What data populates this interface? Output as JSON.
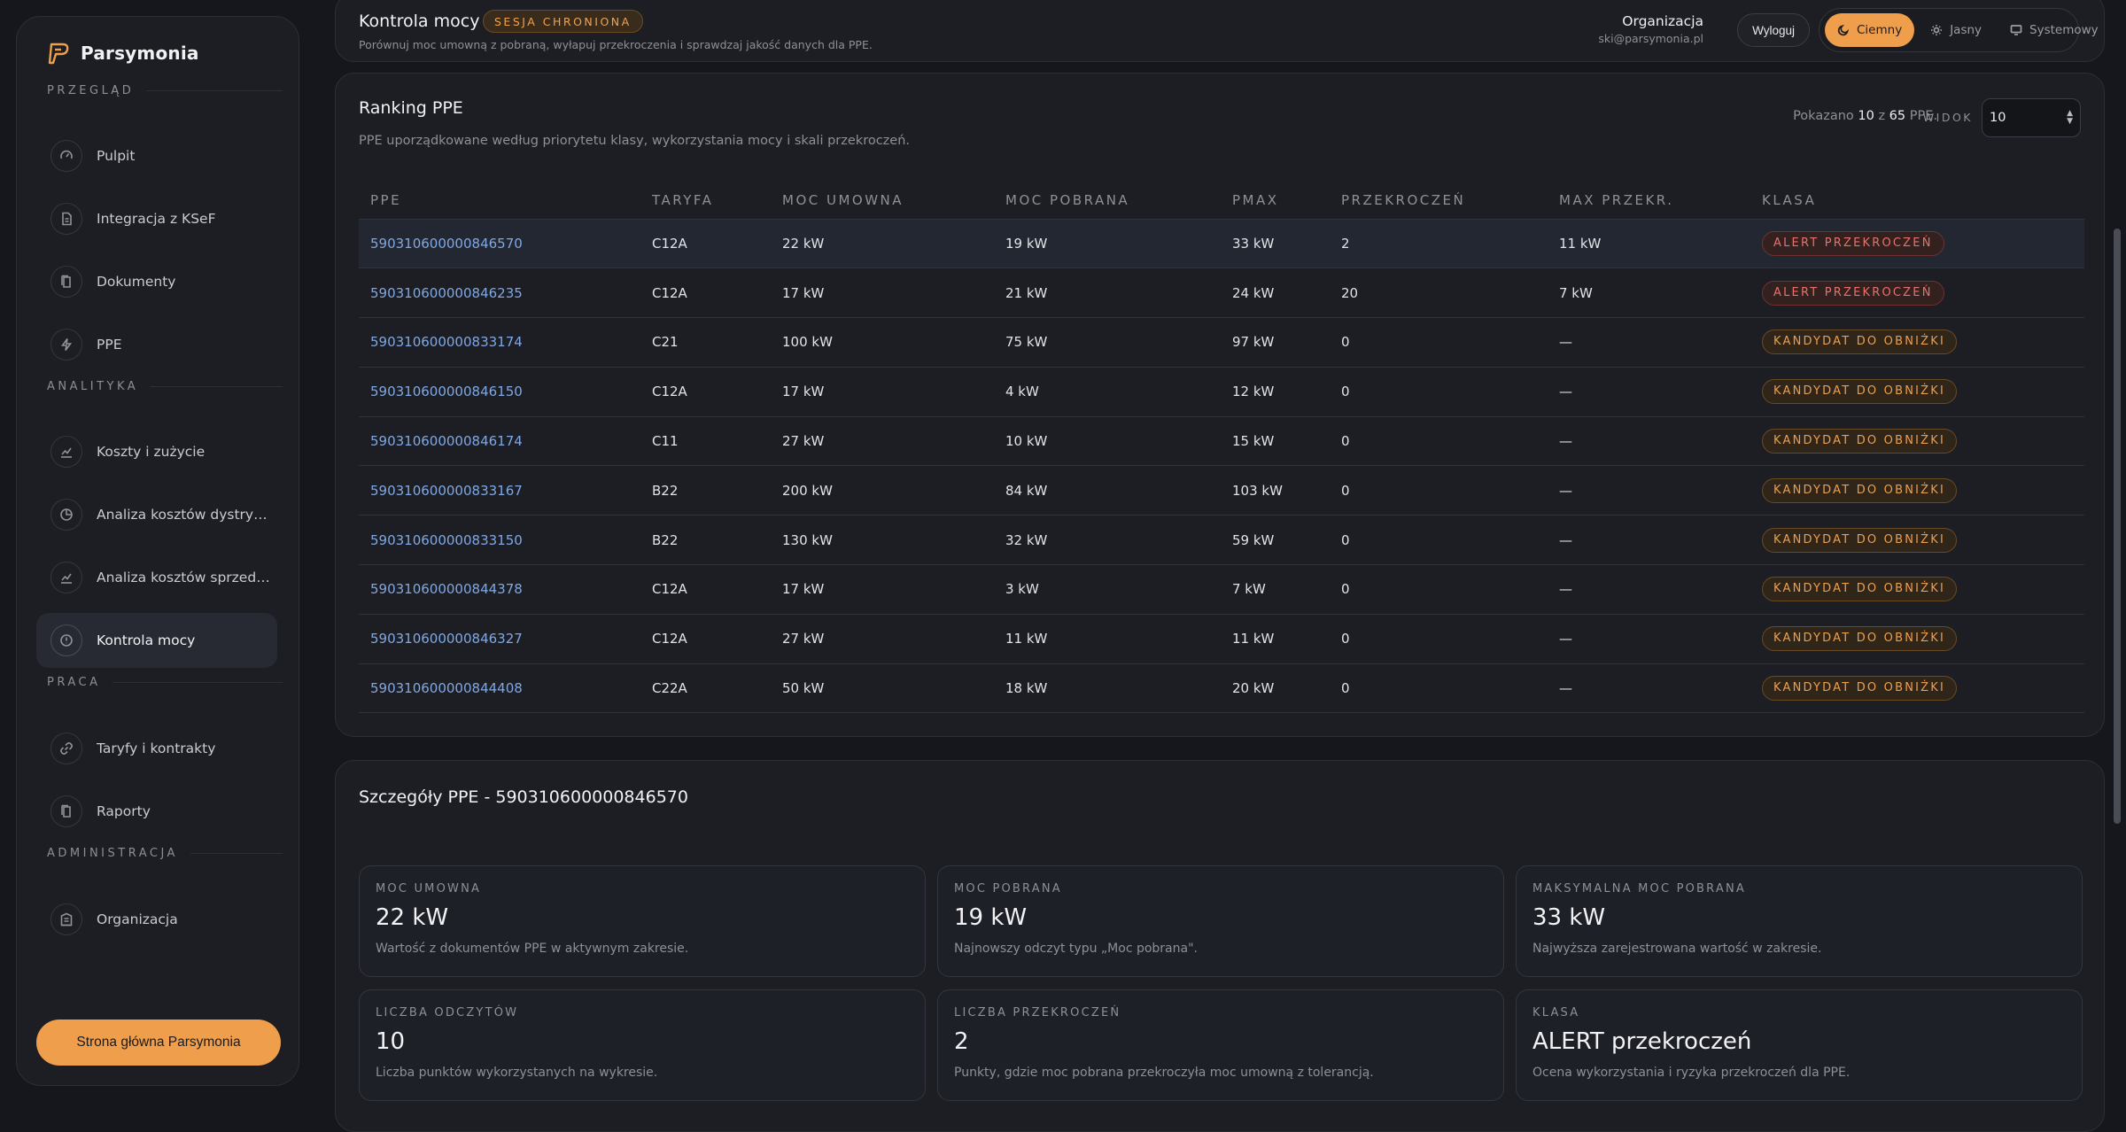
{
  "app": {
    "brand": "Parsymonia"
  },
  "sidebar": {
    "sections": [
      {
        "label": "PRZEGLĄD"
      },
      {
        "label": "ANALITYKA"
      },
      {
        "label": "PRACA"
      },
      {
        "label": "ADMINISTRACJA"
      }
    ],
    "items": [
      {
        "label": "Pulpit",
        "icon": "gauge-icon"
      },
      {
        "label": "Integracja z KSeF",
        "icon": "document-icon"
      },
      {
        "label": "Dokumenty",
        "icon": "documents-icon"
      },
      {
        "label": "PPE",
        "icon": "bolt-icon"
      },
      {
        "label": "Koszty i zużycie",
        "icon": "chart-icon"
      },
      {
        "label": "Analiza kosztów dystrybucji",
        "icon": "pie-icon"
      },
      {
        "label": "Analiza kosztów sprzedaży",
        "icon": "chart-icon"
      },
      {
        "label": "Kontrola mocy",
        "icon": "alert-icon"
      },
      {
        "label": "Taryfy i kontrakty",
        "icon": "link-icon"
      },
      {
        "label": "Raporty",
        "icon": "documents-icon"
      },
      {
        "label": "Organizacja",
        "icon": "building-icon"
      }
    ],
    "home_button": "Strona główna Parsymonia"
  },
  "header": {
    "title": "Kontrola mocy",
    "badge": "SESJA CHRONIONA",
    "subtitle": "Porównuj moc umowną z pobraną, wyłapuj przekroczenia i sprawdzaj jakość danych dla PPE.",
    "org_name": "Organizacja",
    "org_email": "ski@parsymonia.pl",
    "logout": "Wyloguj",
    "themes": [
      "Ciemny",
      "Jasny",
      "Systemowy"
    ]
  },
  "ranking": {
    "title": "Ranking PPE",
    "description": "PPE uporządkowane według priorytetu klasy, wykorzystania mocy i skali przekroczeń.",
    "shown_prefix": "Pokazano",
    "shown_count": "10",
    "shown_of": "z",
    "shown_total": "65",
    "shown_suffix": "PPE.",
    "view_label": "WIDOK",
    "view_value": "10",
    "columns": [
      "PPE",
      "TARYFA",
      "MOC UMOWNA",
      "MOC POBRANA",
      "PMAX",
      "PRZEKROCZEŃ",
      "MAX PRZEKR.",
      "KLASA"
    ],
    "rows": [
      [
        "590310600000846570",
        "C12A",
        "22 kW",
        "19 kW",
        "33 kW",
        "2",
        "11 kW",
        "ALERT PRZEKROCZEŃ"
      ],
      [
        "590310600000846235",
        "C12A",
        "17 kW",
        "21 kW",
        "24 kW",
        "20",
        "7 kW",
        "ALERT PRZEKROCZEŃ"
      ],
      [
        "590310600000833174",
        "C21",
        "100 kW",
        "75 kW",
        "97 kW",
        "0",
        "—",
        "KANDYDAT DO OBNIŻKI"
      ],
      [
        "590310600000846150",
        "C12A",
        "17 kW",
        "4 kW",
        "12 kW",
        "0",
        "—",
        "KANDYDAT DO OBNIŻKI"
      ],
      [
        "590310600000846174",
        "C11",
        "27 kW",
        "10 kW",
        "15 kW",
        "0",
        "—",
        "KANDYDAT DO OBNIŻKI"
      ],
      [
        "590310600000833167",
        "B22",
        "200 kW",
        "84 kW",
        "103 kW",
        "0",
        "—",
        "KANDYDAT DO OBNIŻKI"
      ],
      [
        "590310600000833150",
        "B22",
        "130 kW",
        "32 kW",
        "59 kW",
        "0",
        "—",
        "KANDYDAT DO OBNIŻKI"
      ],
      [
        "590310600000844378",
        "C12A",
        "17 kW",
        "3 kW",
        "7 kW",
        "0",
        "—",
        "KANDYDAT DO OBNIŻKI"
      ],
      [
        "590310600000846327",
        "C12A",
        "27 kW",
        "11 kW",
        "11 kW",
        "0",
        "—",
        "KANDYDAT DO OBNIŻKI"
      ],
      [
        "590310600000844408",
        "C22A",
        "50 kW",
        "18 kW",
        "20 kW",
        "0",
        "—",
        "KANDYDAT DO OBNIŻKI"
      ]
    ],
    "row_classes": [
      "alert",
      "alert",
      "cand",
      "cand",
      "cand",
      "cand",
      "cand",
      "cand",
      "cand",
      "cand"
    ]
  },
  "details": {
    "title": "Szczegóły PPE - 590310600000846570",
    "stats": [
      {
        "label": "MOC UMOWNA",
        "value": "22 kW",
        "note": "Wartość z dokumentów PPE w aktywnym zakresie."
      },
      {
        "label": "MOC POBRANA",
        "value": "19 kW",
        "note": "Najnowszy odczyt typu „Moc pobrana\"."
      },
      {
        "label": "MAKSYMALNA MOC POBRANA",
        "value": "33 kW",
        "note": "Najwyższa zarejestrowana wartość w zakresie."
      },
      {
        "label": "LICZBA ODCZYTÓW",
        "value": "10",
        "note": "Liczba punktów wykorzystanych na wykresie."
      },
      {
        "label": "LICZBA PRZEKROCZEŃ",
        "value": "2",
        "note": "Punkty, gdzie moc pobrana przekroczyła moc umowną z tolerancją."
      },
      {
        "label": "KLASA",
        "value": "ALERT przekroczeń",
        "note": "Ocena wykorzystania i ryzyka przekroczeń dla PPE."
      }
    ]
  },
  "colors": {
    "accent": "#ef9e4c",
    "background": "#15171c",
    "card": "#1c1e24",
    "link": "#7fa8e4",
    "alert": "#e9706b"
  }
}
